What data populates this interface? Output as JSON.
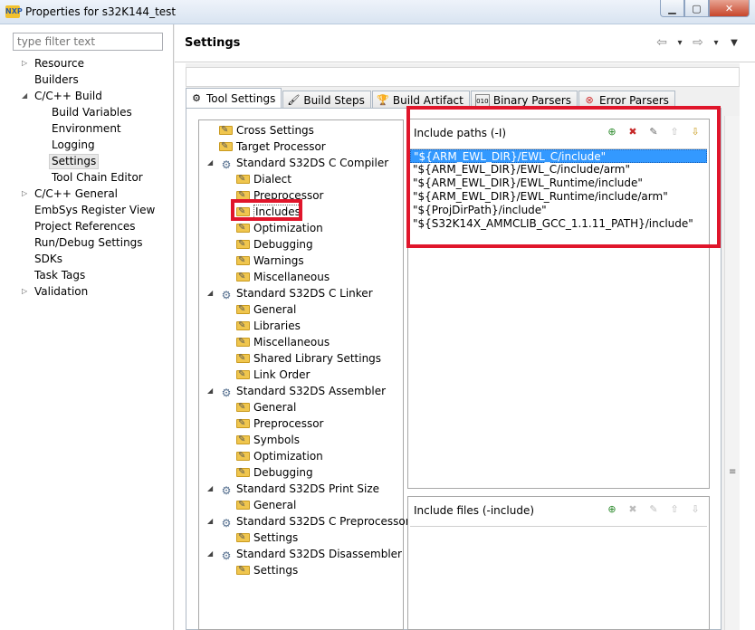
{
  "window": {
    "title": "Properties for s32K144_test",
    "minimize": "▁",
    "maximize": "▢",
    "close": "✕"
  },
  "left": {
    "filter_placeholder": "type filter text",
    "items": [
      {
        "label": "Resource",
        "expander": "▷"
      },
      {
        "label": "Builders",
        "expander": ""
      },
      {
        "label": "C/C++ Build",
        "expander": "◢"
      },
      {
        "label": "Build Variables",
        "expander": ""
      },
      {
        "label": "Environment",
        "expander": ""
      },
      {
        "label": "Logging",
        "expander": ""
      },
      {
        "label": "Settings",
        "expander": ""
      },
      {
        "label": "Tool Chain Editor",
        "expander": ""
      },
      {
        "label": "C/C++ General",
        "expander": "▷"
      },
      {
        "label": "EmbSys Register View",
        "expander": ""
      },
      {
        "label": "Project References",
        "expander": ""
      },
      {
        "label": "Run/Debug Settings",
        "expander": ""
      },
      {
        "label": "SDKs",
        "expander": ""
      },
      {
        "label": "Task Tags",
        "expander": ""
      },
      {
        "label": "Validation",
        "expander": "▷"
      }
    ]
  },
  "header": {
    "title": "Settings",
    "back": "⇦",
    "back_menu": "▾",
    "forward": "⇨",
    "forward_menu": "▾",
    "view_menu": "▼"
  },
  "tabs": [
    {
      "label": "Tool Settings",
      "icon": "⚙"
    },
    {
      "label": "Build Steps",
      "icon": "🖌"
    },
    {
      "label": "Build Artifact",
      "icon": "🏆"
    },
    {
      "label": "Binary Parsers",
      "icon": "010"
    },
    {
      "label": "Error Parsers",
      "icon": "⊗"
    }
  ],
  "tree": [
    {
      "label": "Cross Settings",
      "icon": "folder",
      "expander": ""
    },
    {
      "label": "Target Processor",
      "icon": "folder",
      "expander": ""
    },
    {
      "label": "Standard S32DS C Compiler",
      "icon": "gear",
      "expander": "◢"
    },
    {
      "label": "Dialect",
      "icon": "folder",
      "expander": ""
    },
    {
      "label": "Preprocessor",
      "icon": "folder",
      "expander": ""
    },
    {
      "label": "Includes",
      "icon": "folder",
      "expander": ""
    },
    {
      "label": "Optimization",
      "icon": "folder",
      "expander": ""
    },
    {
      "label": "Debugging",
      "icon": "folder",
      "expander": ""
    },
    {
      "label": "Warnings",
      "icon": "folder",
      "expander": ""
    },
    {
      "label": "Miscellaneous",
      "icon": "folder",
      "expander": ""
    },
    {
      "label": "Standard S32DS C Linker",
      "icon": "gear",
      "expander": "◢"
    },
    {
      "label": "General",
      "icon": "folder",
      "expander": ""
    },
    {
      "label": "Libraries",
      "icon": "folder",
      "expander": ""
    },
    {
      "label": "Miscellaneous",
      "icon": "folder",
      "expander": ""
    },
    {
      "label": "Shared Library Settings",
      "icon": "folder",
      "expander": ""
    },
    {
      "label": "Link Order",
      "icon": "folder",
      "expander": ""
    },
    {
      "label": "Standard S32DS Assembler",
      "icon": "gear",
      "expander": "◢"
    },
    {
      "label": "General",
      "icon": "folder",
      "expander": ""
    },
    {
      "label": "Preprocessor",
      "icon": "folder",
      "expander": ""
    },
    {
      "label": "Symbols",
      "icon": "folder",
      "expander": ""
    },
    {
      "label": "Optimization",
      "icon": "folder",
      "expander": ""
    },
    {
      "label": "Debugging",
      "icon": "folder",
      "expander": ""
    },
    {
      "label": "Standard S32DS Print Size",
      "icon": "gear",
      "expander": "◢"
    },
    {
      "label": "General",
      "icon": "folder",
      "expander": ""
    },
    {
      "label": "Standard S32DS C Preprocessor",
      "icon": "gear",
      "expander": "◢"
    },
    {
      "label": "Settings",
      "icon": "folder",
      "expander": ""
    },
    {
      "label": "Standard S32DS Disassembler",
      "icon": "gear",
      "expander": "◢"
    },
    {
      "label": "Settings",
      "icon": "folder",
      "expander": ""
    }
  ],
  "include_paths": {
    "title": "Include paths (-I)",
    "tools": [
      "⊕",
      "✖",
      "✎",
      "⇧",
      "⇩"
    ],
    "paths": [
      "\"${ARM_EWL_DIR}/EWL_C/include\"",
      "\"${ARM_EWL_DIR}/EWL_C/include/arm\"",
      "\"${ARM_EWL_DIR}/EWL_Runtime/include\"",
      "\"${ARM_EWL_DIR}/EWL_Runtime/include/arm\"",
      "\"${ProjDirPath}/include\"",
      "\"${S32K14X_AMMCLIB_GCC_1.1.11_PATH}/include\""
    ]
  },
  "include_files": {
    "title": "Include files (-include)",
    "tools": [
      "⊕",
      "✖",
      "✎",
      "⇧",
      "⇩"
    ]
  },
  "colors": {
    "highlight_red": "#e0162b",
    "selection_blue": "#3399ff"
  }
}
